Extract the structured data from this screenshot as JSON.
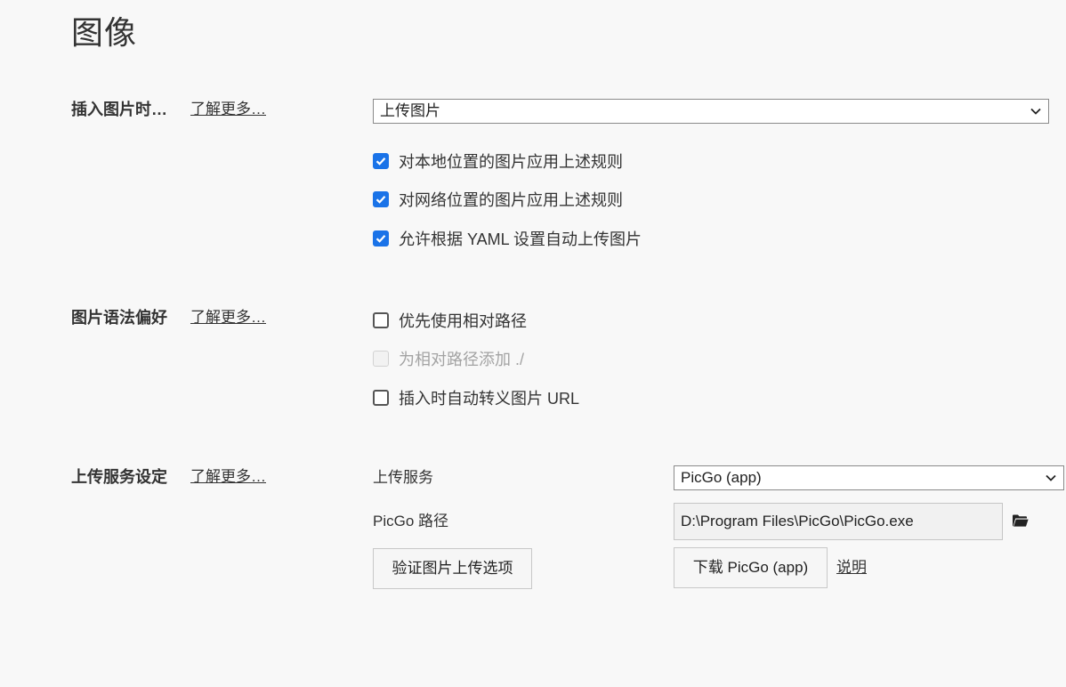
{
  "page": {
    "title": "图像"
  },
  "sections": {
    "insert": {
      "label": "插入图片时…",
      "learn_more": "了解更多…",
      "select_value": "上传图片",
      "options": [
        {
          "label": "对本地位置的图片应用上述规则",
          "checked": true,
          "disabled": false
        },
        {
          "label": "对网络位置的图片应用上述规则",
          "checked": true,
          "disabled": false
        },
        {
          "label": "允许根据 YAML 设置自动上传图片",
          "checked": true,
          "disabled": false
        }
      ]
    },
    "syntax": {
      "label": "图片语法偏好",
      "learn_more": "了解更多…",
      "options": [
        {
          "label": "优先使用相对路径",
          "checked": false,
          "disabled": false
        },
        {
          "label": "为相对路径添加 ./",
          "checked": false,
          "disabled": true
        },
        {
          "label": "插入时自动转义图片 URL",
          "checked": false,
          "disabled": false
        }
      ]
    },
    "upload": {
      "label": "上传服务设定",
      "learn_more": "了解更多…",
      "service_label": "上传服务",
      "service_value": "PicGo (app)",
      "path_label": "PicGo 路径",
      "path_value": "D:\\Program Files\\PicGo\\PicGo.exe",
      "verify_button": "验证图片上传选项",
      "download_button": "下载 PicGo (app)",
      "help_link": "说明"
    }
  },
  "icons": {
    "chevron": "chevron-down-icon",
    "folder": "folder-icon",
    "check": "checkmark-icon"
  },
  "colors": {
    "checkbox_accent": "#1a73e8"
  }
}
